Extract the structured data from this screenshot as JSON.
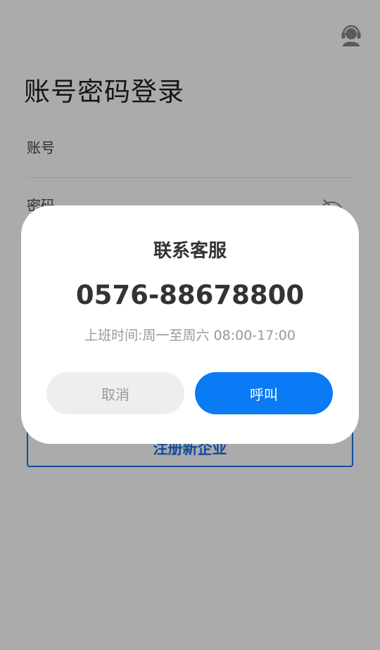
{
  "login": {
    "title": "账号密码登录",
    "account_placeholder": "账号",
    "password_placeholder": "密码",
    "register_label": "注册新企业"
  },
  "dialog": {
    "title": "联系客服",
    "phone": "0576-88678800",
    "hours": "上班时间:周一至周六 08:00-17:00",
    "cancel_label": "取消",
    "call_label": "呼叫"
  },
  "icons": {
    "support": "customer-service-headset",
    "password_toggle": "eye-off"
  },
  "colors": {
    "accent": "#0a7af5",
    "register_border": "#1a73e8",
    "overlay": "rgba(0,0,0,0.33)"
  }
}
